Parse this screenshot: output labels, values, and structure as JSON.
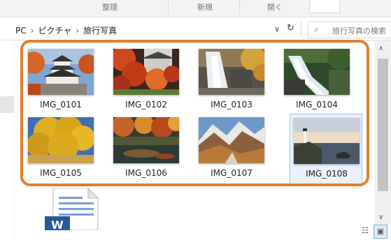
{
  "ribbon": {
    "tabs": [
      "整理",
      "新規",
      "開く"
    ]
  },
  "address_bar": {
    "path": [
      "PC",
      "ピクチャ",
      "旅行写真"
    ],
    "separator": "›",
    "dropdown_icon": "chevron-down-icon",
    "refresh_icon": "refresh-icon"
  },
  "search": {
    "placeholder": "旅行写真の検索",
    "icon": "search-icon"
  },
  "files": [
    {
      "name": "IMG_0101",
      "subject": "castle-autumn"
    },
    {
      "name": "IMG_0102",
      "subject": "castle-red-leaves"
    },
    {
      "name": "IMG_0103",
      "subject": "waterfall-autumn"
    },
    {
      "name": "IMG_0104",
      "subject": "waterfall-forest"
    },
    {
      "name": "IMG_0105",
      "subject": "ginkgo-tree"
    },
    {
      "name": "IMG_0106",
      "subject": "autumn-pond"
    },
    {
      "name": "IMG_0107",
      "subject": "mountain-valley"
    },
    {
      "name": "IMG_0108",
      "subject": "lighthouse-sunset"
    }
  ],
  "selected_file": "IMG_0108",
  "colors": {
    "highlight": "#e37e2c",
    "selection_bg": "#e9f2fb",
    "selection_border": "#99c7f0"
  },
  "view_buttons": [
    {
      "icon": "details-view-icon",
      "active": false
    },
    {
      "icon": "large-icons-view-icon",
      "active": true
    }
  ]
}
